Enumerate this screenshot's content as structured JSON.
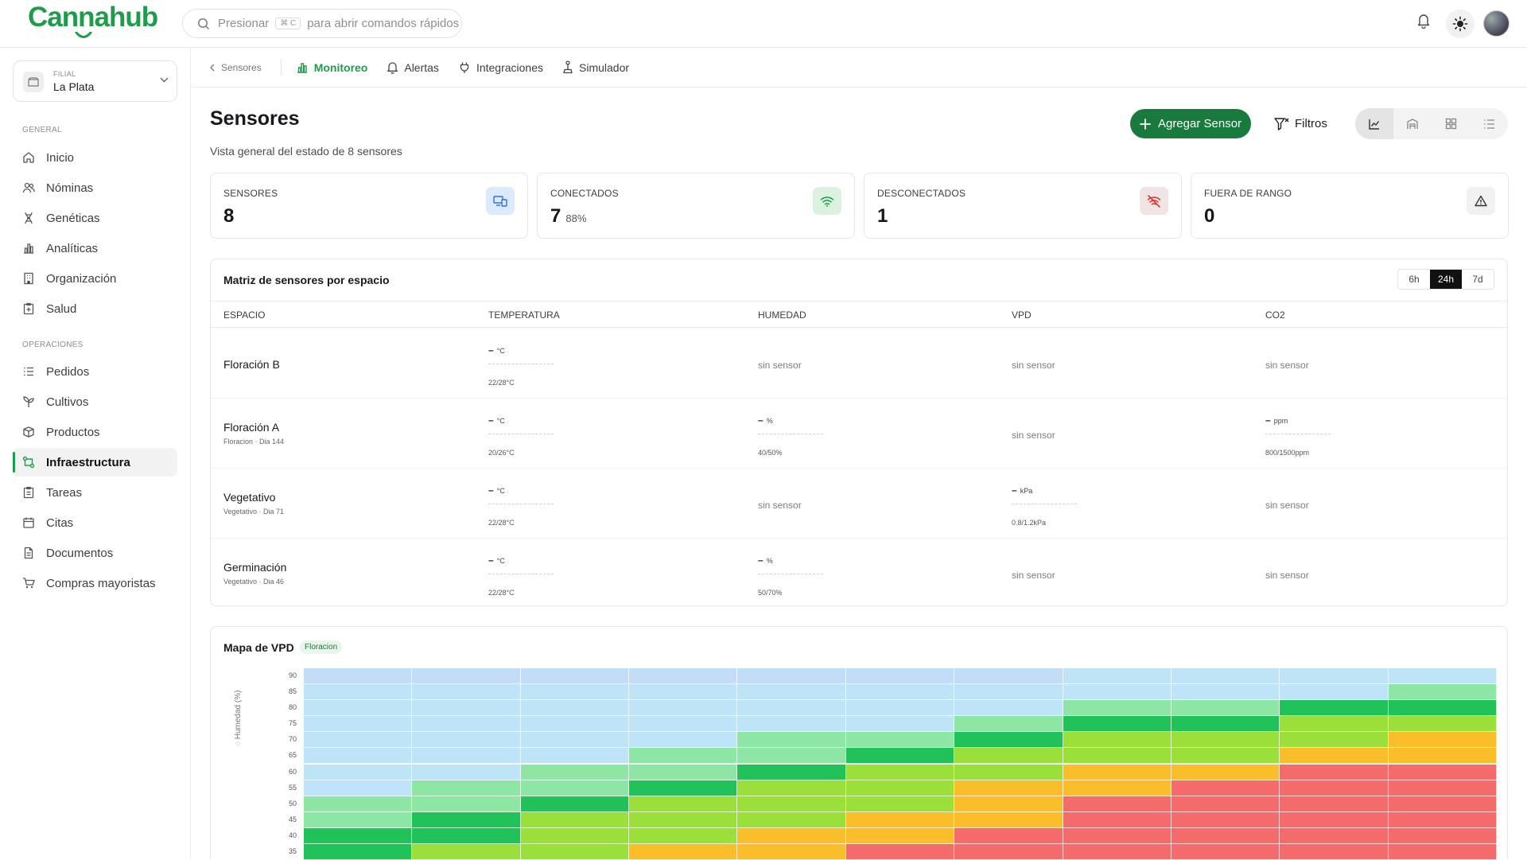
{
  "header": {
    "brand": "Cannahub",
    "search": {
      "prefix": "Presionar",
      "shortcut": "⌘ C",
      "suffix": "para abrir comandos rápidos"
    }
  },
  "sidebar": {
    "filial": {
      "label": "FILIAL",
      "value": "La Plata"
    },
    "sections": [
      {
        "title": "GENERAL",
        "items": [
          {
            "label": "Inicio",
            "icon": "home-icon"
          },
          {
            "label": "Nóminas",
            "icon": "users-icon"
          },
          {
            "label": "Genéticas",
            "icon": "dna-icon"
          },
          {
            "label": "Analíticas",
            "icon": "bar-chart-icon"
          },
          {
            "label": "Organización",
            "icon": "building-icon"
          },
          {
            "label": "Salud",
            "icon": "clipboard-icon"
          }
        ]
      },
      {
        "title": "OPERACIONES",
        "items": [
          {
            "label": "Pedidos",
            "icon": "list-icon"
          },
          {
            "label": "Cultivos",
            "icon": "sprout-icon"
          },
          {
            "label": "Productos",
            "icon": "box-icon"
          },
          {
            "label": "Infraestructura",
            "icon": "network-icon",
            "active": true
          },
          {
            "label": "Tareas",
            "icon": "clipboard-list-icon"
          },
          {
            "label": "Citas",
            "icon": "calendar-icon"
          },
          {
            "label": "Documentos",
            "icon": "file-icon"
          },
          {
            "label": "Compras mayoristas",
            "icon": "cart-icon"
          }
        ]
      }
    ]
  },
  "tabs": {
    "back": "Sensores",
    "items": [
      {
        "label": "Monitoreo",
        "selected": true
      },
      {
        "label": "Alertas"
      },
      {
        "label": "Integraciones"
      },
      {
        "label": "Simulador"
      }
    ]
  },
  "page": {
    "title": "Sensores",
    "subtitle": "Vista general del estado de 8 sensores",
    "add_label": "Agregar Sensor",
    "filter_label": "Filtros"
  },
  "stats": [
    {
      "label": "SENSORES",
      "value": "8",
      "sub": ""
    },
    {
      "label": "CONECTADOS",
      "value": "7",
      "sub": "88%"
    },
    {
      "label": "DESCONECTADOS",
      "value": "1",
      "sub": ""
    },
    {
      "label": "FUERA DE RANGO",
      "value": "0",
      "sub": ""
    }
  ],
  "matrix": {
    "title": "Matriz de sensores por espacio",
    "ranges": [
      "6h",
      "24h",
      "7d"
    ],
    "selected_range": "24h",
    "columns": [
      "ESPACIO",
      "TEMPERATURA",
      "HUMEDAD",
      "VPD",
      "CO2"
    ],
    "rows": [
      {
        "name": "Floración B",
        "sub": "",
        "temp": {
          "value": "–",
          "unit": "°C",
          "range": "22/28°C"
        },
        "hum": {
          "none": "sin sensor"
        },
        "vpd": {
          "none": "sin sensor"
        },
        "co2": {
          "none": "sin sensor"
        }
      },
      {
        "name": "Floración A",
        "sub": "Floracion · Dia 144",
        "temp": {
          "value": "–",
          "unit": "°C",
          "range": "20/26°C"
        },
        "hum": {
          "value": "–",
          "unit": "%",
          "range": "40/50%"
        },
        "vpd": {
          "none": "sin sensor"
        },
        "co2": {
          "value": "–",
          "unit": "ppm",
          "range": "800/1500ppm"
        }
      },
      {
        "name": "Vegetativo",
        "sub": "Vegetativo · Dia 71",
        "temp": {
          "value": "–",
          "unit": "°C",
          "range": "22/28°C"
        },
        "hum": {
          "none": "sin sensor"
        },
        "vpd": {
          "value": "–",
          "unit": "kPa",
          "range": "0.8/1.2kPa"
        },
        "co2": {
          "none": "sin sensor"
        }
      },
      {
        "name": "Germinación",
        "sub": "Vegetativo · Dia 46",
        "temp": {
          "value": "–",
          "unit": "°C",
          "range": "22/28°C"
        },
        "hum": {
          "value": "–",
          "unit": "%",
          "range": "50/70%"
        },
        "vpd": {
          "none": "sin sensor"
        },
        "co2": {
          "none": "sin sensor"
        }
      }
    ]
  },
  "vpd_map": {
    "title": "Mapa de VPD",
    "badge": "Floracion",
    "ylabel": "Humedad (%)",
    "colors": {
      "A": "#c3dcf7",
      "B": "#bfe3f7",
      "C": "#8ee6a5",
      "D": "#22c25a",
      "E": "#9be03a",
      "F": "#f9be2a",
      "G": "#f56b6b"
    },
    "humidity": [
      90,
      85,
      80,
      75,
      70,
      65,
      60,
      55,
      50,
      45,
      40,
      35
    ],
    "rows": [
      "AAAAAAABBBB",
      "BBBBBBBBBBC",
      "BBBBBBBCCDD",
      "BBBBBBCDDEE",
      "BBBBCCDEEEF",
      "BBBCCDEEEFF",
      "BBCCDEEFFGG",
      "BCCDEEFFGGG",
      "CCDEEEFGGGG",
      "CDEEEFFGGGG",
      "DDEEFFGGGGG",
      "DEEFFGGGGGG"
    ]
  }
}
